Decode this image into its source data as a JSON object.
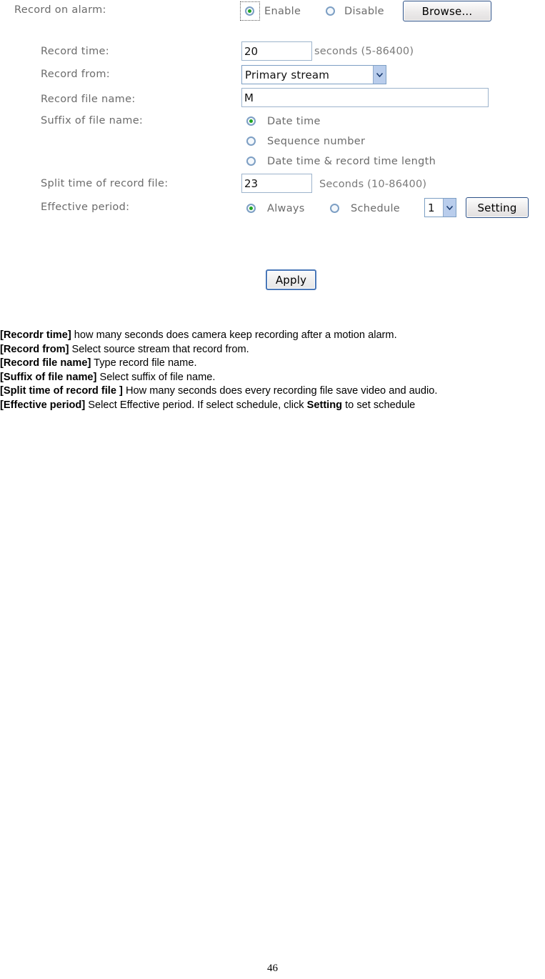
{
  "form": {
    "rows": {
      "record_on_alarm": {
        "label": "Record on alarm:",
        "enable_label": "Enable",
        "disable_label": "Disable",
        "selected": "Enable",
        "browse_label": "Browse..."
      },
      "record_time": {
        "label": "Record time:",
        "value": "20",
        "hint": "seconds (5-86400)"
      },
      "record_from": {
        "label": "Record from:",
        "value": "Primary stream",
        "options": [
          "Primary stream"
        ]
      },
      "record_file_name": {
        "label": "Record file name:",
        "value": "M"
      },
      "suffix_of_file_name": {
        "label": "Suffix of file name:",
        "options": [
          "Date time",
          "Sequence number",
          "Date time & record time length"
        ],
        "selected": "Date time"
      },
      "split_time": {
        "label": "Split time of record file:",
        "value": "23",
        "hint": "Seconds (10-86400)"
      },
      "effective_period": {
        "label": "Effective period:",
        "always_label": "Always",
        "schedule_label": "Schedule",
        "selected": "Always",
        "schedule_value": "1",
        "schedule_options": [
          "1"
        ],
        "setting_label": "Setting"
      }
    },
    "apply_label": "Apply"
  },
  "description": {
    "lines": [
      {
        "term": "[Recordr time]",
        "text": " how many seconds does camera keep recording after a motion alarm."
      },
      {
        "term": "[Record from]",
        "text": " Select source stream that record from."
      },
      {
        "term": "[Record file name]",
        "text": " Type record file name."
      },
      {
        "term": "[Suffix of file name]",
        "text": " Select suffix of file name."
      },
      {
        "term": "[Split time of record file ]",
        "text": " How many seconds does every recording file save video and audio."
      },
      {
        "term": "[Effective period]",
        "text": " Select Effective period. If select schedule, click ",
        "emphasis": "Setting",
        "text_after": " to set schedule"
      }
    ]
  },
  "footer": {
    "page_number": "46"
  },
  "colors": {
    "label_gray": "#6b6b6b",
    "radio_ring": "#7d9fc4",
    "radio_dot": "#22a522",
    "input_border": "#9db4cc",
    "button_border": "#2b4f86",
    "select_arrow_bg": "#b9cdec"
  }
}
